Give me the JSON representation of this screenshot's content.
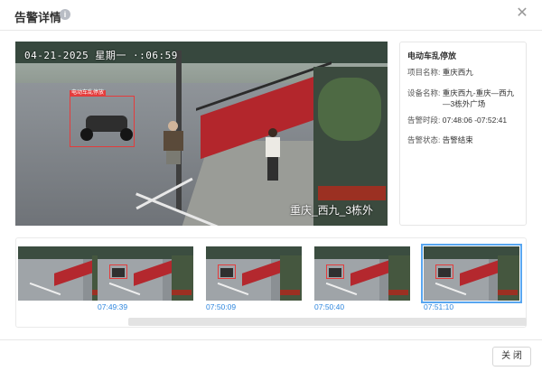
{
  "dialog": {
    "title": "告警详情",
    "close_button_label": "关 闭"
  },
  "camera": {
    "timestamp": "04-21-2025 星期一 ·:06:59",
    "overlay_label": "重庆_西九_3栋外",
    "detection_label": "电动车乱停放"
  },
  "detail": {
    "heading": "电动车乱停放",
    "project_key": "项目名称:",
    "project_value": "重庆西九",
    "device_key": "设备名称:",
    "device_value_1": "重庆西九-重庆—西九",
    "device_value_2": "—3栋外广场",
    "period_key": "告警时段:",
    "period_value": "07:48:06 -07:52:41",
    "status_key": "告警状态:",
    "status_value": "告警结束",
    "status_color": "#2db83d"
  },
  "thumbnails": [
    {
      "time": ""
    },
    {
      "time": "07:49:39"
    },
    {
      "time": "07:50:09"
    },
    {
      "time": "07:50:40"
    },
    {
      "time": "07:51:10"
    }
  ],
  "colors": {
    "accent": "#2e86de",
    "selection": "#58a6f0",
    "detection_box": "#e43c3c"
  }
}
